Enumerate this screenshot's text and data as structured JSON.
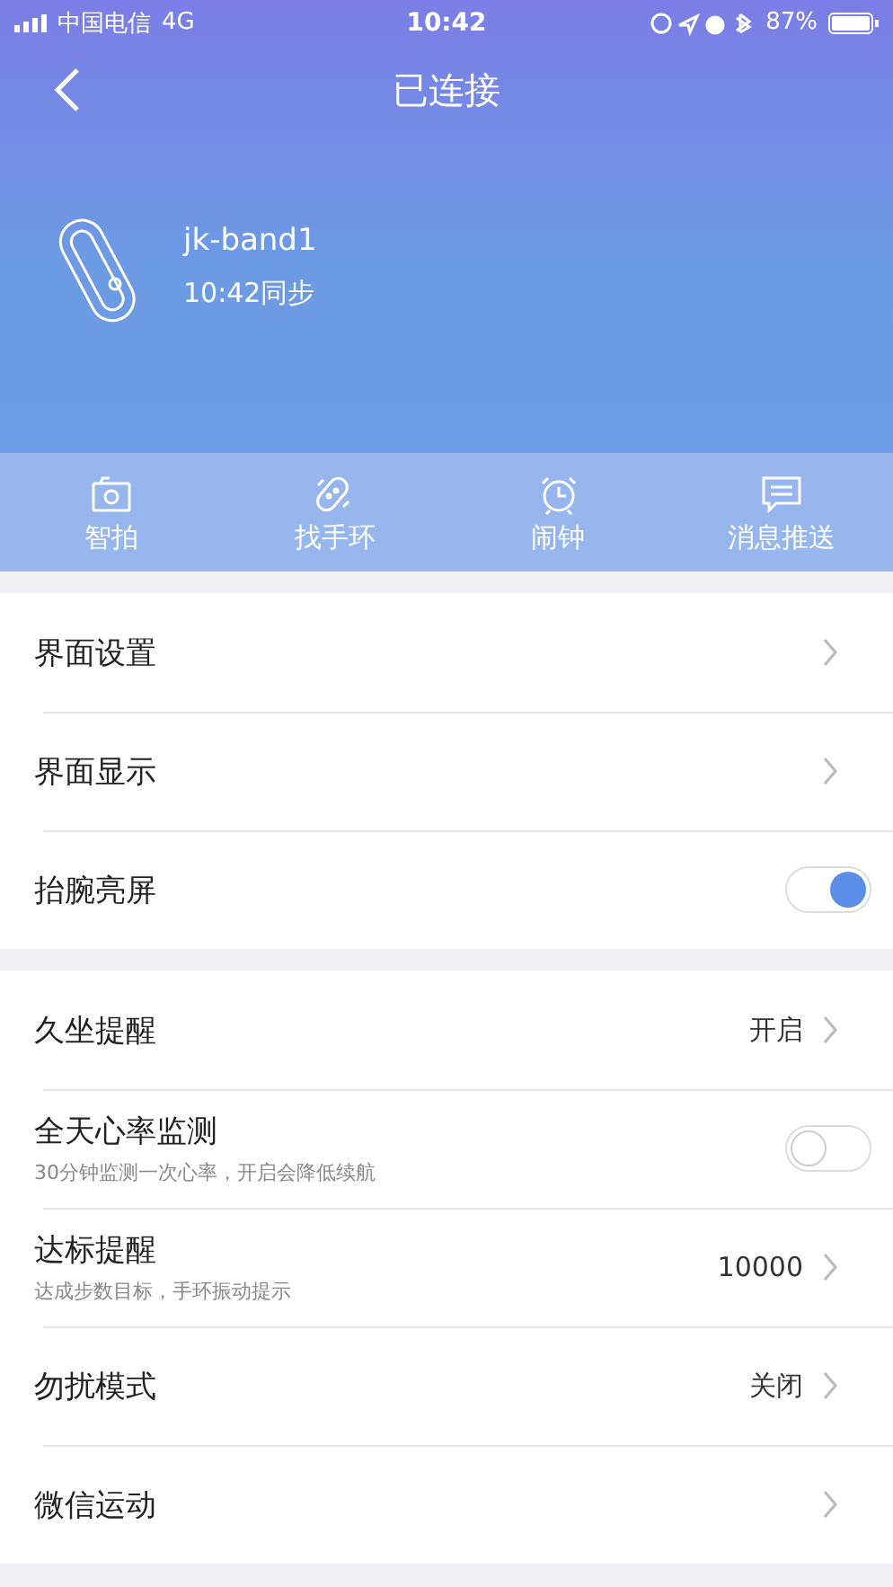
{
  "status_bar": {
    "carrier": "中国电信",
    "network": "4G",
    "time": "10:42",
    "battery": "87%"
  },
  "nav": {
    "title": "已连接"
  },
  "device": {
    "name": "jk-band1",
    "sync": "10:42同步"
  },
  "quick_actions": [
    {
      "label": "智拍",
      "kind": "camera"
    },
    {
      "label": "找手环",
      "kind": "band"
    },
    {
      "label": "闹钟",
      "kind": "alarm"
    },
    {
      "label": "消息推送",
      "kind": "message"
    }
  ],
  "groups": [
    {
      "rows": [
        {
          "kind": "link",
          "title": "界面设置"
        },
        {
          "kind": "link",
          "title": "界面显示"
        },
        {
          "kind": "toggle",
          "title": "抬腕亮屏",
          "on": true
        }
      ]
    },
    {
      "rows": [
        {
          "kind": "link",
          "title": "久坐提醒",
          "value": "开启"
        },
        {
          "kind": "toggle",
          "title": "全天心率监测",
          "subtitle": "30分钟监测一次心率，开启会降低续航",
          "on": false
        },
        {
          "kind": "link",
          "title": "达标提醒",
          "subtitle": "达成步数目标，手环振动提示",
          "value": "10000"
        },
        {
          "kind": "link",
          "title": "勿扰模式",
          "value": "关闭"
        },
        {
          "kind": "link",
          "title": "微信运动"
        }
      ]
    }
  ]
}
